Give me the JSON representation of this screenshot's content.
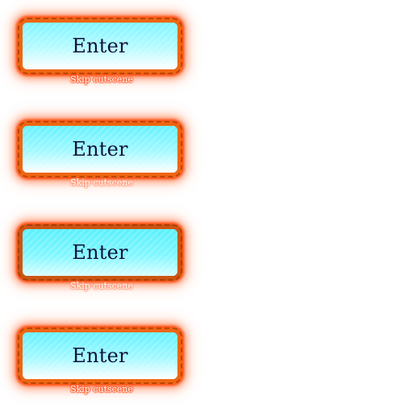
{
  "buttons": [
    {
      "label": "Enter",
      "caption": "Skip cutscene",
      "state": "normal"
    },
    {
      "label": "Enter",
      "caption": "Skip cutscene",
      "state": "hover"
    },
    {
      "label": "Enter",
      "caption": "Skip cutscene",
      "state": "pressed"
    },
    {
      "label": "Enter",
      "caption": "Skip cutscene",
      "state": "focused"
    }
  ],
  "colors": {
    "frame": "#ee6611",
    "glow": "#ff5a2a",
    "fill_top": "#7ff6ff",
    "fill_bottom": "#ffffff",
    "label": "#10113a"
  }
}
